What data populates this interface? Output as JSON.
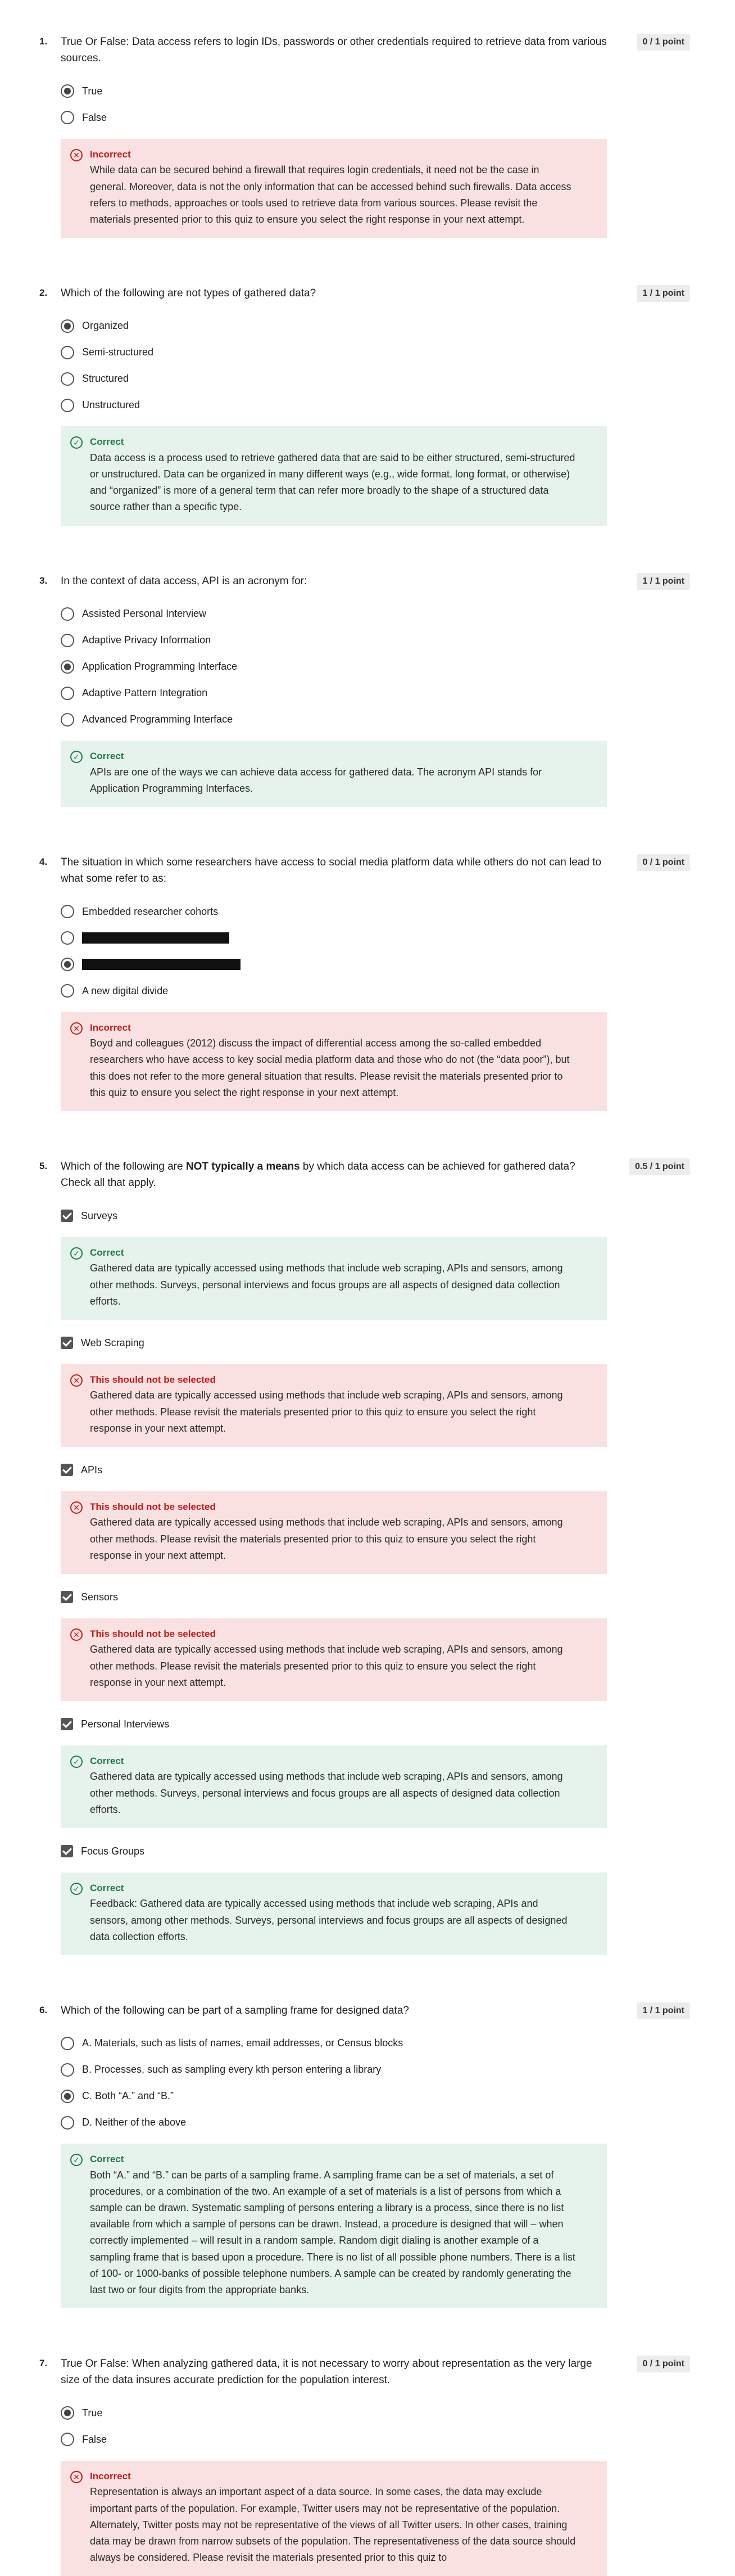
{
  "q1": {
    "num": "1.",
    "text": "True Or False: Data access refers to login IDs, passwords or other credentials required to retrieve data from various sources.",
    "score": "0 / 1 point",
    "options": [
      "True",
      "False"
    ],
    "selected": 0,
    "feedback": {
      "status": "Incorrect",
      "body": "While data can be secured behind a firewall that requires login credentials, it need not be the case in general. Moreover, data is not the only information that can be accessed behind such firewalls. Data access refers to methods, approaches or tools used to retrieve data from various sources. Please revisit the materials presented prior to this quiz to ensure you select the right response in your next attempt."
    }
  },
  "q2": {
    "num": "2.",
    "text": "Which of the following are not types of gathered data?",
    "score": "1 / 1 point",
    "options": [
      "Organized",
      "Semi-structured",
      "Structured",
      "Unstructured"
    ],
    "selected": 0,
    "feedback": {
      "status": "Correct",
      "body": "Data access is a process used to retrieve gathered data that are said to be either structured, semi-structured or unstructured. Data can be organized in many different ways (e.g., wide format, long format, or otherwise) and “organized” is more of a general term that can refer more broadly to the shape of a structured data source rather than a specific type."
    }
  },
  "q3": {
    "num": "3.",
    "text": "In the context of data access, API is an acronym for:",
    "score": "1 / 1 point",
    "options": [
      "Assisted Personal Interview",
      "Adaptive Privacy Information",
      "Application Programming Interface",
      "Adaptive Pattern Integration",
      "Advanced Programming Interface"
    ],
    "selected": 2,
    "feedback": {
      "status": "Correct",
      "body": "APIs are one of the ways we can achieve data access for gathered data. The acronym API stands for Application Programming Interfaces."
    }
  },
  "q4": {
    "num": "4.",
    "text": "The situation in which some researchers have access to social media platform data while others do not can lead to what some refer to as:",
    "score": "0 / 1 point",
    "options": [
      "Embedded researcher cohorts",
      "",
      "",
      "A new digital divide"
    ],
    "selected": 2,
    "feedback": {
      "status": "Incorrect",
      "body": "Boyd and colleagues (2012) discuss the impact of differential access among the so-called embedded researchers who have access to key social media platform data and those who do not (the “data poor”), but this does not refer to the more general situation that results. Please revisit the materials presented prior to this quiz to ensure you select the right response in your next attempt."
    }
  },
  "q5": {
    "num": "5.",
    "text_pre": "Which of the following are ",
    "text_bold": "NOT typically a means",
    "text_post": " by which data access can be achieved for gathered data? Check all that apply.",
    "score": "0.5 / 1 point",
    "items": [
      {
        "label": "Surveys",
        "status": "Correct",
        "body": "Gathered data are typically accessed using methods that include web scraping, APIs and sensors, among other methods. Surveys, personal interviews and focus groups are all aspects of designed data collection efforts."
      },
      {
        "label": "Web Scraping",
        "status": "This should not be selected",
        "body": "Gathered data are typically accessed using methods that include web scraping, APIs and sensors, among other methods. Please revisit the materials presented prior to this quiz to ensure you select the right response in your next attempt."
      },
      {
        "label": "APIs",
        "status": "This should not be selected",
        "body": "Gathered data are typically accessed using methods that include web scraping, APIs and sensors, among other methods. Please revisit the materials presented prior to this quiz to ensure you select the right response in your next attempt."
      },
      {
        "label": "Sensors",
        "status": "This should not be selected",
        "body": "Gathered data are typically accessed using methods that include web scraping, APIs and sensors, among other methods. Please revisit the materials presented prior to this quiz to ensure you select the right response in your next attempt."
      },
      {
        "label": "Personal Interviews",
        "status": "Correct",
        "body": "Gathered data are typically accessed using methods that include web scraping, APIs and sensors, among other methods. Surveys, personal interviews and focus groups are all aspects of designed data collection efforts."
      },
      {
        "label": "Focus Groups",
        "status": "Correct",
        "body": "Feedback: Gathered data are typically accessed using methods that include web scraping, APIs and sensors, among other methods. Surveys, personal interviews and focus groups are all aspects of designed data collection efforts."
      }
    ]
  },
  "q6": {
    "num": "6.",
    "text": "Which of the following can be part of a sampling frame for designed data?",
    "score": "1 / 1 point",
    "options": [
      "A. Materials, such as lists of names, email addresses, or Census blocks",
      "B. Processes, such as sampling every kth person entering a library",
      "C. Both “A.” and “B.”",
      "D. Neither of the above"
    ],
    "selected": 2,
    "feedback": {
      "status": "Correct",
      "body": "Both “A.” and “B.” can be parts of a sampling frame. A sampling frame can be a set of materials, a set of procedures, or a combination of the two. An example of a set of materials is a list of persons from which a sample can be drawn. Systematic sampling of persons entering a library is a process, since there is no list available from which a sample of persons can be drawn. Instead, a procedure is designed that will – when correctly implemented – will result in a random sample. Random digit dialing is another example of a sampling frame that is based upon a procedure. There is no list of all possible phone numbers. There is a list of 100- or 1000-banks of possible telephone numbers. A sample can be created by randomly generating the last two or four digits from the appropriate banks."
    }
  },
  "q7": {
    "num": "7.",
    "text": "True Or False: When analyzing gathered data, it is not necessary to worry about representation as the very large size of the data insures accurate prediction for the population interest.",
    "score": "0 / 1 point",
    "options": [
      "True",
      "False"
    ],
    "selected": 0,
    "feedback": {
      "status": "Incorrect",
      "body": "Representation is always an important aspect of a data source. In some cases, the data may exclude important parts of the population. For example, Twitter users may not be representative of the population. Alternately, Twitter posts may not be representative of the views of all Twitter users. In other cases, training data may be drawn from narrow subsets of the population. The representativeness of the data source should always be considered. Please revisit the materials presented prior to this quiz to"
    }
  }
}
